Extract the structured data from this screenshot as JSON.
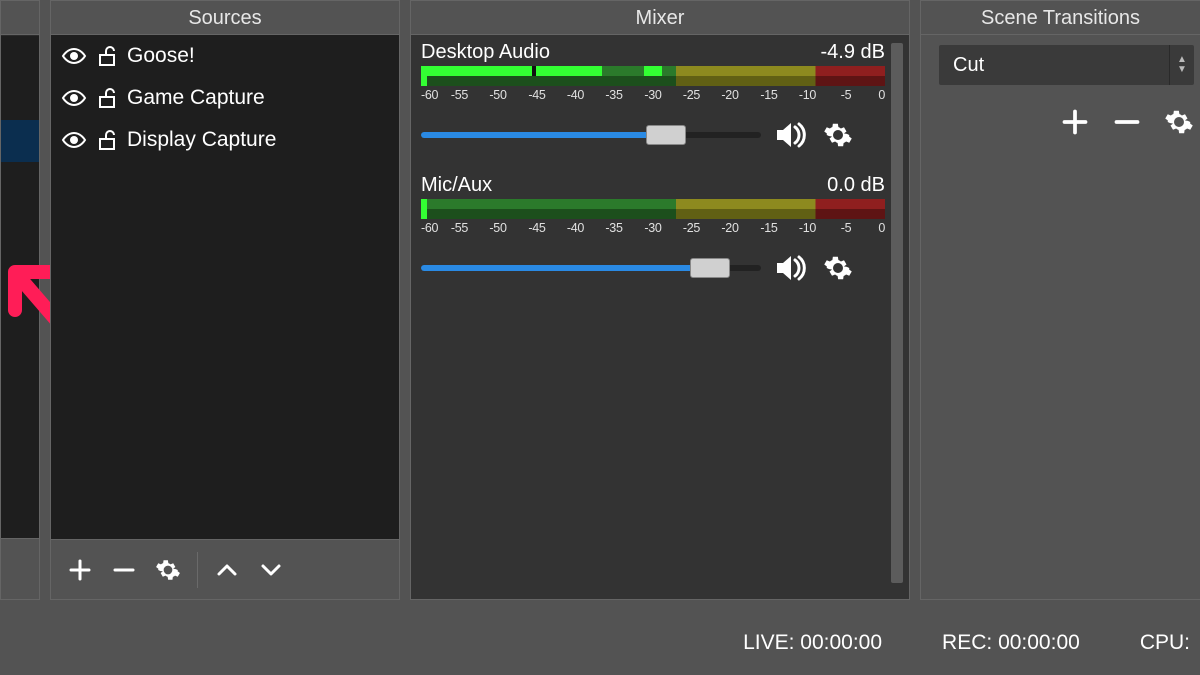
{
  "panels": {
    "sources_title": "Sources",
    "mixer_title": "Mixer",
    "transitions_title": "Scene Transitions"
  },
  "sources": {
    "items": [
      {
        "label": "Goose!"
      },
      {
        "label": "Game Capture"
      },
      {
        "label": "Display Capture"
      }
    ]
  },
  "mixer": {
    "ticks": [
      "-60",
      "-55",
      "-50",
      "-45",
      "-40",
      "-35",
      "-30",
      "-25",
      "-20",
      "-15",
      "-10",
      "-5",
      "0"
    ],
    "channels": [
      {
        "name": "Desktop Audio",
        "db": "-4.9 dB",
        "slider_percent": 72,
        "light_percent": 39,
        "spot_percent": 48
      },
      {
        "name": "Mic/Aux",
        "db": "0.0 dB",
        "slider_percent": 85,
        "light_percent": 0,
        "spot_percent": 0
      }
    ]
  },
  "transitions": {
    "current": "Cut"
  },
  "status": {
    "live_label": "LIVE:",
    "live_time": "00:00:00",
    "rec_label": "REC:",
    "rec_time": "00:00:00",
    "cpu_label": "CPU:"
  }
}
